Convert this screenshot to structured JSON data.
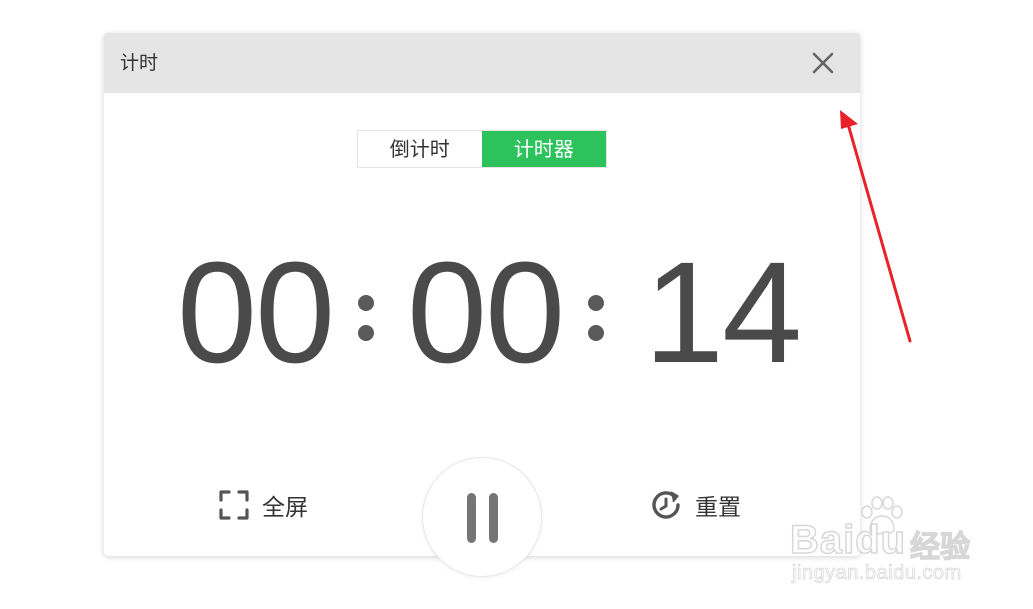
{
  "window": {
    "title": "计时",
    "close_icon": "close-icon"
  },
  "tabs": [
    {
      "label": "倒计时",
      "active": false
    },
    {
      "label": "计时器",
      "active": true
    }
  ],
  "timer": {
    "hours": "00",
    "minutes": "00",
    "seconds": "14"
  },
  "controls": {
    "fullscreen_label": "全屏",
    "fullscreen_icon": "fullscreen-icon",
    "pause_icon": "pause-icon",
    "reset_label": "重置",
    "reset_icon": "reset-icon"
  },
  "colors": {
    "accent": "#2dc25c",
    "titlebar": "#e5e5e5",
    "digits": "#4a4a4a",
    "annotation_arrow": "#e8212a"
  },
  "watermark": {
    "brand": "Baidu",
    "brand_cn": "经验",
    "url": "jingyan.baidu.com"
  }
}
